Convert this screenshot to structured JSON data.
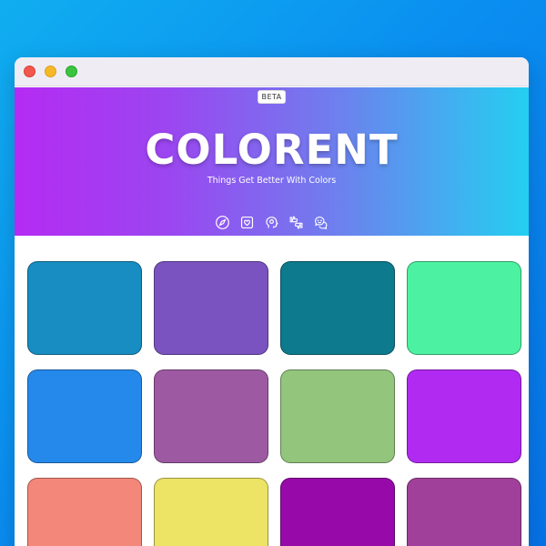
{
  "app": {
    "badge": "BETA",
    "title": "COLORENT",
    "tagline": "Things Get Better With Colors"
  },
  "nav_icons": [
    "compass-icon",
    "heart-frame-icon",
    "head-heart-icon",
    "thumbs-up-down-icon",
    "chat-emoji-icon"
  ],
  "palette": [
    "#178dc1",
    "#7a53c0",
    "#0d7a8e",
    "#4cf2a1",
    "#2589ec",
    "#9d5aa3",
    "#93c57d",
    "#b12af2",
    "#f38779",
    "#ede364",
    "#970aa9",
    "#a1409a"
  ]
}
